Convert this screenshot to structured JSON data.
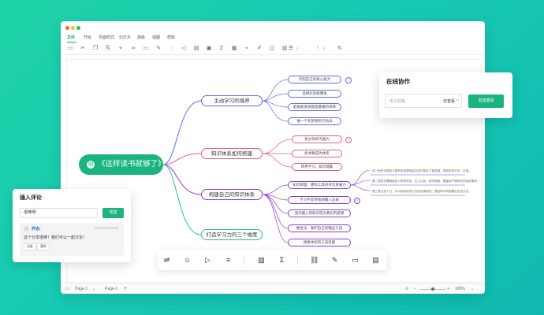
{
  "window": {
    "menu": [
      "文件",
      "开始",
      "页面样式",
      "幻灯片",
      "高级",
      "视图",
      "帮助"
    ],
    "active_menu": "文件",
    "toolbar_zoom_a": "2",
    "toolbar_zoom_b": "2"
  },
  "mindmap": {
    "root": "《这样读书就够了》",
    "branches": [
      {
        "label": "主动学习的境界",
        "color": "#5b6cf0",
        "leaves": [
          "识别自己的核心能力",
          "选择比较能爆发",
          "超级能发现那是最难的项目",
          "做一个有梦想的行动派"
        ],
        "badge": "1"
      },
      {
        "label": "知识体系如何搭建",
        "color": "#e85a8d",
        "leaves": [
          "拆分你的沟通力",
          "拆书要成为体系",
          "跨界学习、知识储蓄"
        ],
        "badge": "1"
      },
      {
        "label": "构建自己的知识体系",
        "color": "#8a3fd1",
        "leaves": [
          "知识管理：建构工具的对比发展力",
          "学习不是单独地输入记录",
          "混沌输入到知识成为我们的结果",
          "硬坐法：保护自己的输出工具",
          "想要体验的三段思路"
        ],
        "badge": "2",
        "notes": [
          "将一份知识框架与原有的成果相结合进行整合了新发展，得到未来行为，应用。",
          "第二类知识要借鉴前人思考积淀，比之以前，制作两面，要保持严格有效的相关素材。",
          "第三类大多十分，可以用较好的方式来创造新的，是各种不同前期的生成方式。"
        ]
      },
      {
        "label": "打造学习力的三个维度",
        "color": "#2cbf8b",
        "leaves": []
      }
    ]
  },
  "collab_panel": {
    "title": "在线协作",
    "email_placeholder": "电子邮箱",
    "permission": "仅查看",
    "send_button": "发送邀请"
  },
  "comment_panel": {
    "title": "插入评论",
    "input_value": "很棒呀!",
    "send_button": "发送",
    "comment": {
      "author": "乔治:",
      "timestamp": "2021-09-08 09:02",
      "text": "这个分享很棒！我们可以一起讨论！",
      "actions": [
        "回复",
        "删除"
      ]
    }
  },
  "statusbar": {
    "page_label": "Page-1",
    "page_tab": "Page-1",
    "add": "+",
    "zoom": "100%"
  },
  "colors": {
    "brand": "#1ab57f",
    "background": "#17c9b4"
  }
}
